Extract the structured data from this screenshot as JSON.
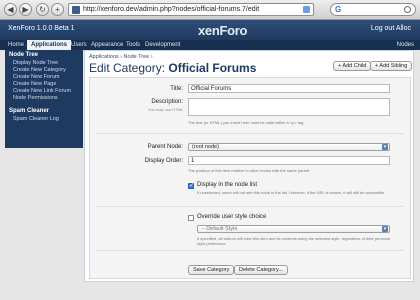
{
  "browser": {
    "url": "http://xenforo.dev/admin.php?nodes/official-forums.7/edit",
    "back_icon": "◀",
    "forward_icon": "▶",
    "reload_icon": "↻",
    "add_icon": "+",
    "google_mark": "G"
  },
  "header": {
    "version": "XenForo 1.0.0 Beta 1",
    "logo": "xenForo",
    "logout": "Log out Alloc"
  },
  "tabs": {
    "items": [
      "Home",
      "Applications",
      "Users",
      "Appearance",
      "Tools",
      "Development"
    ],
    "right_label": "Nodes"
  },
  "sidebar": {
    "section1": "Node Tree",
    "items1": [
      "Display Node Tree",
      "Create New Category",
      "Create New Forum",
      "Create New Page",
      "Create New Link Forum",
      "Node Permissions"
    ],
    "section2": "Spam Cleaner",
    "items2": [
      "Spam Cleaner Log"
    ]
  },
  "main": {
    "breadcrumb": "Applications ›   Node Tree ›",
    "title_prefix": "Edit Category: ",
    "title_name": "Official Forums",
    "add_child": "+ Add Child",
    "add_sibling": "+ Add Sibling"
  },
  "form": {
    "title_label": "Title:",
    "title_value": "Official Forums",
    "desc_label": "Description:",
    "desc_sub": "You may use HTML",
    "desc_hint": "The text (or HTML) you insert here must be valid within a <p> tag.",
    "parent_label": "Parent Node:",
    "parent_value": "(root node)",
    "order_label": "Display Order:",
    "order_value": "1",
    "order_hint": "The position of this item relative to other nodes with the same parent.",
    "display_label": "Display in the node list",
    "display_checked": true,
    "display_hint": "If unselected, users will not see this node in the list. However, if the URL is known, it will still be accessible.",
    "override_label": "Override user style choice",
    "override_checked": false,
    "style_value": "-- Default Style",
    "style_hint": "If specified, all visitors will view this item and its contents using the selected style, regardless of their personal style preference.",
    "save": "Save Category",
    "delete": "Delete Category..."
  }
}
